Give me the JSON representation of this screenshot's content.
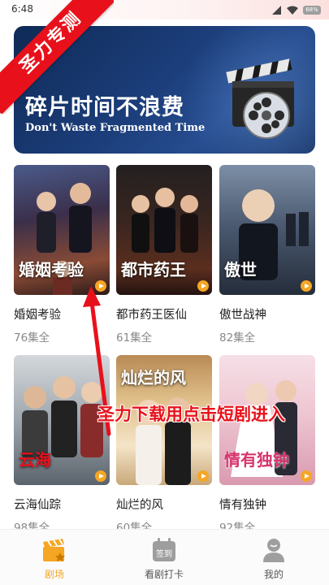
{
  "status_bar": {
    "time": "6:48",
    "battery": "68%"
  },
  "watermark": {
    "ribbon": "圣力专测"
  },
  "banner": {
    "title": "碎片时间不浪费",
    "subtitle": "Don't Waste Fragmented Time",
    "slides": 3,
    "active_slide": 2
  },
  "dramas": [
    {
      "title": "婚姻考验",
      "episodes": "76集全",
      "poster_text": "婚姻考验"
    },
    {
      "title": "都市药王医仙",
      "episodes": "61集全",
      "poster_text": "都市药王"
    },
    {
      "title": "傲世战神",
      "episodes": "82集全",
      "poster_text": "傲世"
    },
    {
      "title": "云海仙踪",
      "episodes": "98集全",
      "poster_text": "云海"
    },
    {
      "title": "灿烂的风",
      "episodes": "60集全",
      "poster_text": "灿烂的风"
    },
    {
      "title": "情有独钟",
      "episodes": "92集全",
      "poster_text": "情有独钟"
    }
  ],
  "annotation": {
    "text": "圣力下载用点击短剧进入"
  },
  "bottom_nav": {
    "items": [
      {
        "label": "剧场",
        "icon": "clapperboard-icon",
        "active": true
      },
      {
        "label": "看剧打卡",
        "icon": "checkin-calendar-icon",
        "active": false,
        "icon_text": "签到"
      },
      {
        "label": "我的",
        "icon": "user-icon",
        "active": false
      }
    ]
  },
  "colors": {
    "accent": "#f5a623",
    "watermark": "#e8111b",
    "banner_bg": "#1b3d79"
  }
}
